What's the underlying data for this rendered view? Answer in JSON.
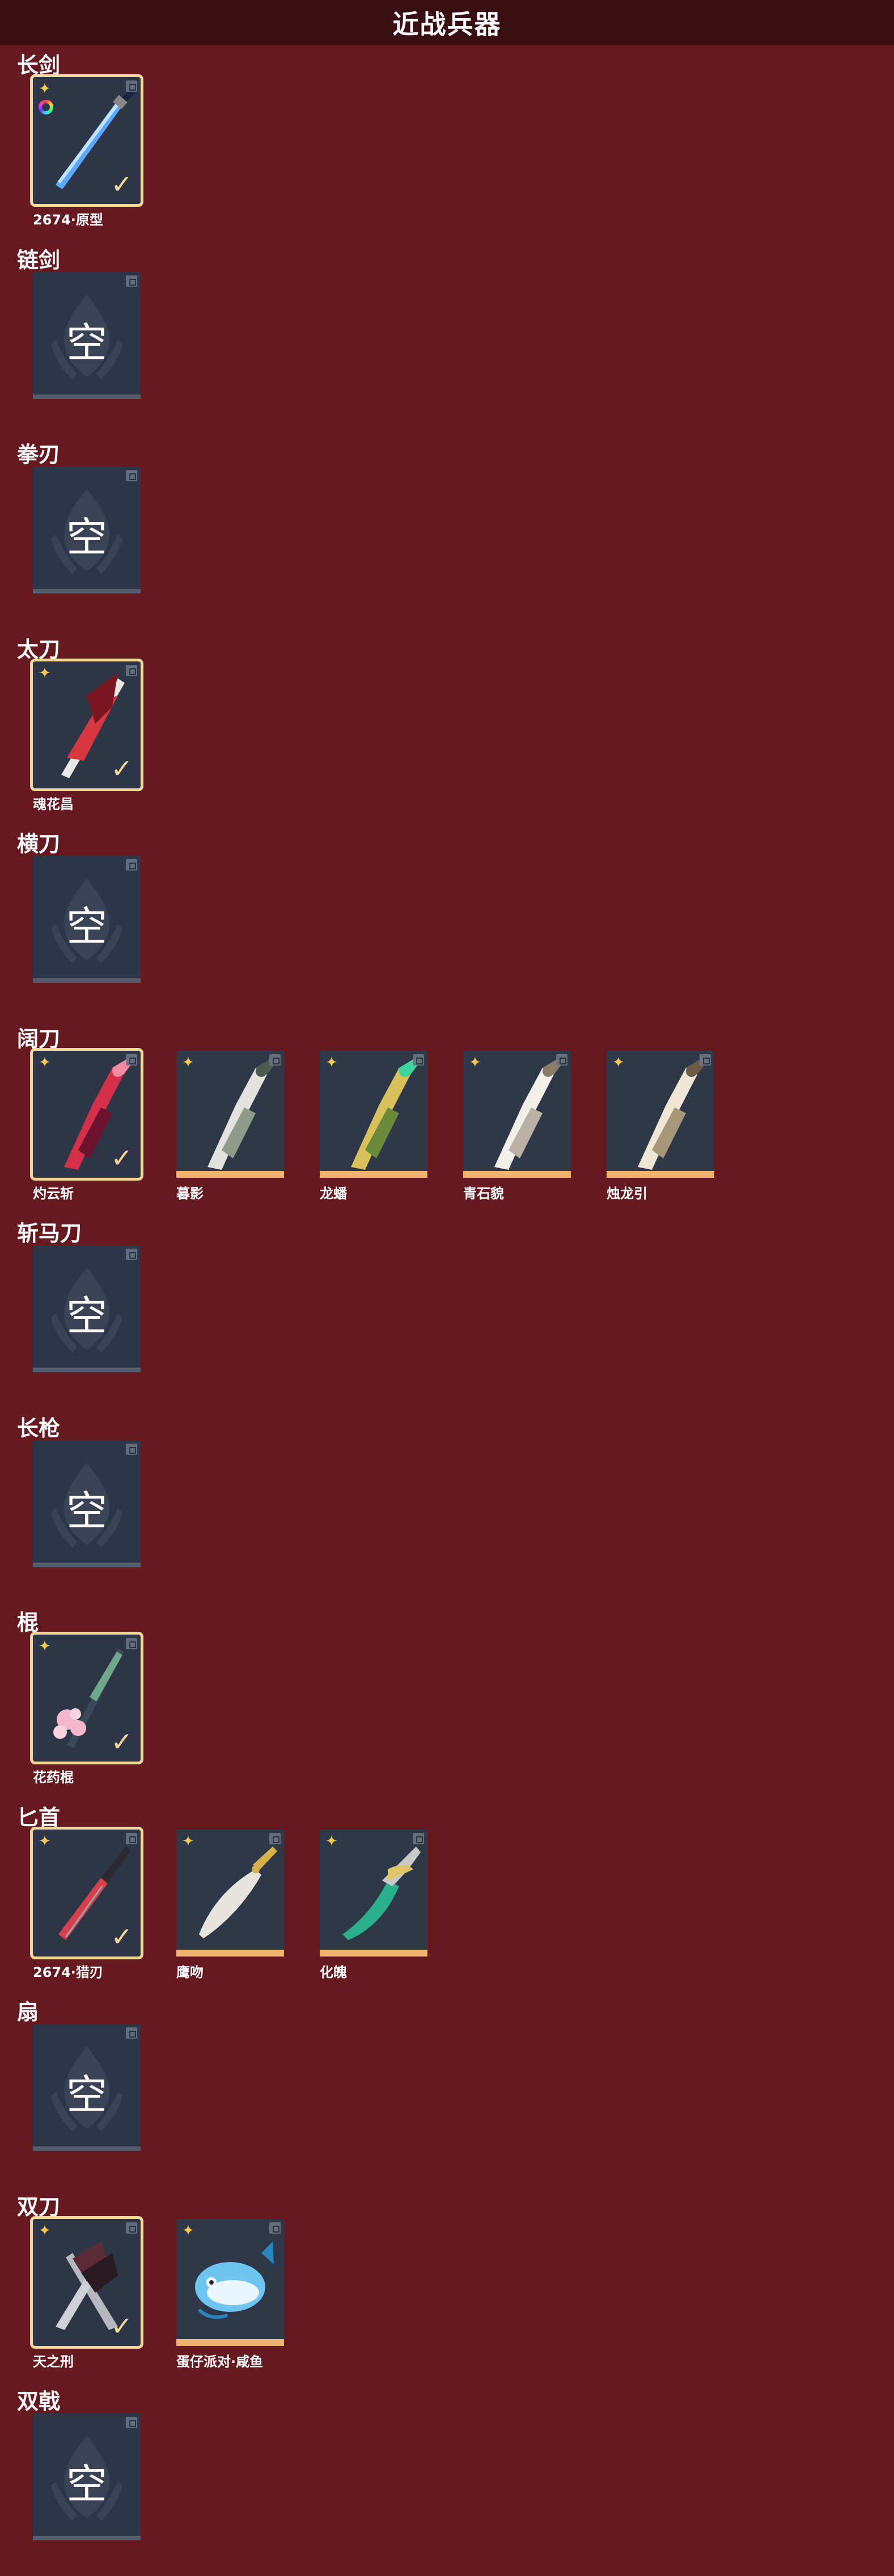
{
  "header": {
    "title": "近战兵器"
  },
  "empty_label": "空",
  "categories": [
    {
      "name": "长剑",
      "items": [
        {
          "name": "2674·原型",
          "selected": true,
          "art": "sword-blue",
          "ring": true
        }
      ]
    },
    {
      "name": "链剑",
      "items": []
    },
    {
      "name": "拳刃",
      "items": []
    },
    {
      "name": "太刀",
      "items": [
        {
          "name": "魂花昌",
          "selected": true,
          "art": "katana-red"
        }
      ]
    },
    {
      "name": "横刀",
      "items": []
    },
    {
      "name": "阔刀",
      "items": [
        {
          "name": "灼云斩",
          "selected": true,
          "art": "broad-red"
        },
        {
          "name": "暮影",
          "selected": false,
          "art": "broad-silver"
        },
        {
          "name": "龙蟠",
          "selected": false,
          "art": "broad-gold"
        },
        {
          "name": "青石貌",
          "selected": false,
          "art": "broad-white"
        },
        {
          "name": "烛龙引",
          "selected": false,
          "art": "broad-bone"
        }
      ]
    },
    {
      "name": "斩马刀",
      "items": []
    },
    {
      "name": "长枪",
      "items": []
    },
    {
      "name": "棍",
      "items": [
        {
          "name": "花药棍",
          "selected": true,
          "art": "staff-flower"
        }
      ]
    },
    {
      "name": "匕首",
      "items": [
        {
          "name": "2674·猎刃",
          "selected": true,
          "art": "dagger-red"
        },
        {
          "name": "鹰吻",
          "selected": false,
          "art": "dagger-scimitar"
        },
        {
          "name": "化魄",
          "selected": false,
          "art": "dagger-green"
        }
      ]
    },
    {
      "name": "扇",
      "items": []
    },
    {
      "name": "双刀",
      "items": [
        {
          "name": "天之刑",
          "selected": true,
          "art": "dual-dark"
        },
        {
          "name": "蛋仔派对·咸鱼",
          "selected": false,
          "art": "dual-fish"
        }
      ]
    },
    {
      "name": "双戟",
      "items": []
    }
  ]
}
